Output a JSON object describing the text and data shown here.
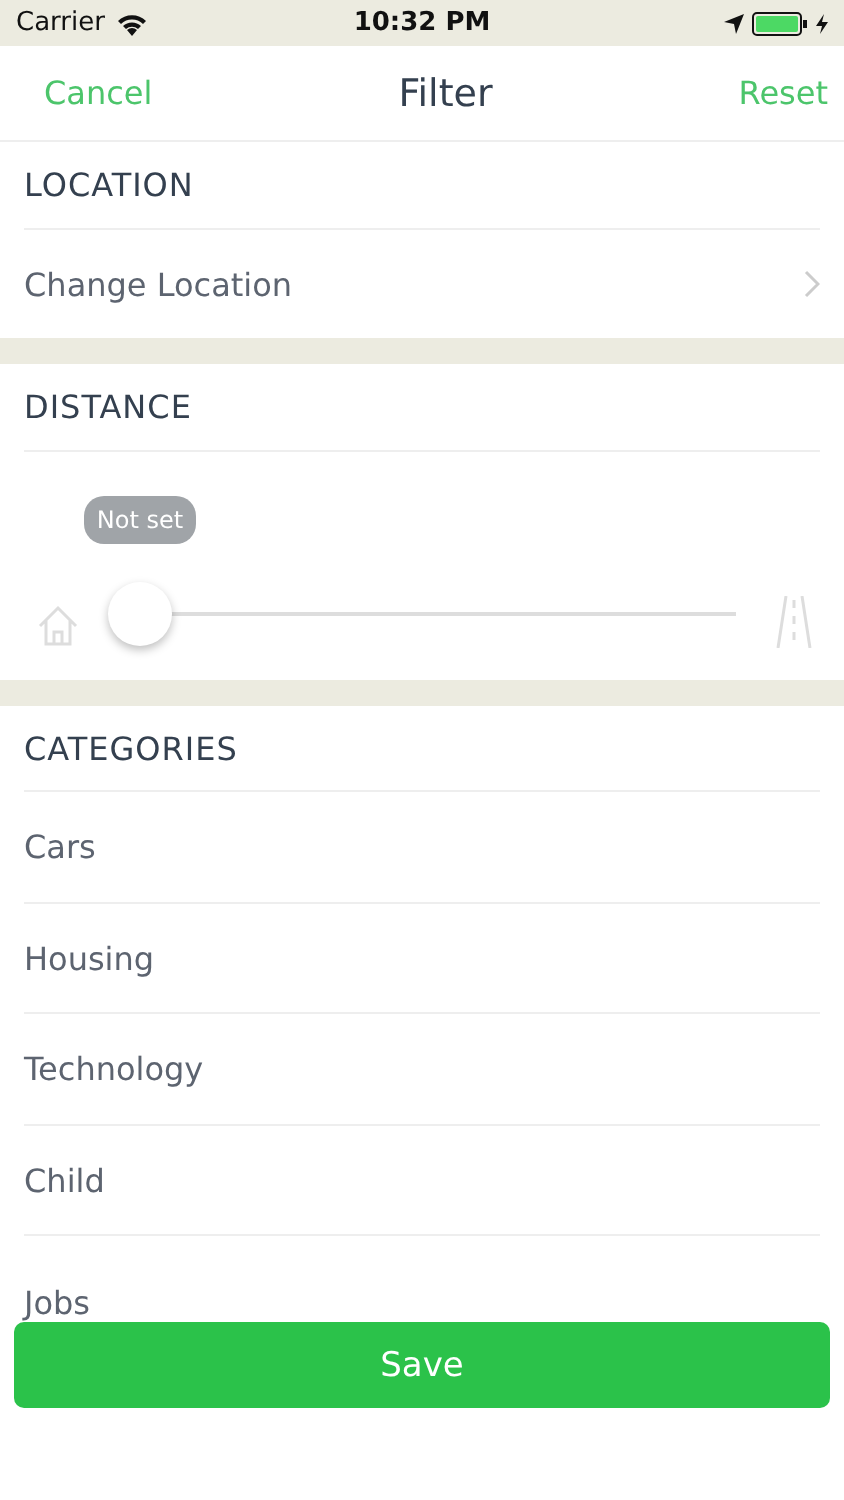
{
  "status_bar": {
    "carrier": "Carrier",
    "time": "10:32 PM"
  },
  "nav": {
    "left": "Cancel",
    "title": "Filter",
    "right": "Reset"
  },
  "location": {
    "header": "LOCATION",
    "row": "Change Location"
  },
  "distance": {
    "header": "DISTANCE",
    "tooltip": "Not set",
    "level": 0
  },
  "categories": {
    "header": "CATEGORIES",
    "items": [
      {
        "label": "Cars"
      },
      {
        "label": "Housing"
      },
      {
        "label": "Technology"
      },
      {
        "label": "Child"
      },
      {
        "label": "Jobs"
      }
    ]
  },
  "save": "Save"
}
